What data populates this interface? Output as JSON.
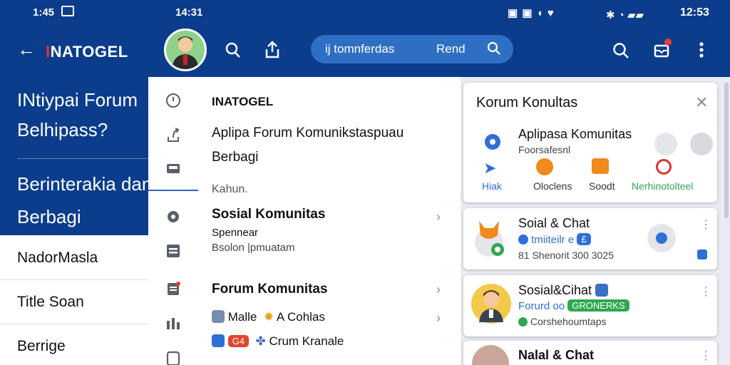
{
  "left_pane": {
    "status_time": "1:45",
    "brand_prefix": "I",
    "brand_rest": "NATOGEL",
    "heading_line1": "INtiypai Forum",
    "heading_line2": "Belhipass?",
    "tagline_line1": "Berinterakia dan",
    "tagline_line2": "Berbagi",
    "menu_items": [
      "NadorMasla",
      "Title Soan",
      "Berrige"
    ]
  },
  "status_bar": {
    "time": "14:31",
    "right_clock": "12:53"
  },
  "search": {
    "text": "ij tomnferdas",
    "action": "Rend"
  },
  "mid_panel": {
    "brand": "INATOGEL",
    "intro_line1": "Aplipa Forum Komunikstaspuau",
    "intro_line2": "Berbagi",
    "section_label": "Kahun.",
    "social_title": "Sosial Komunitas",
    "social_sub1": "Spennear",
    "social_sub2": "Bsolon |pmuatam",
    "forum_title": "Forum Komunitas",
    "forum_item1_a": "Malle",
    "forum_item1_b": "A Cohlas",
    "forum_item2_badge": "G4",
    "forum_item2_text": "Crum Kranale"
  },
  "cards": {
    "komunitas": {
      "title": "Korum Konultas",
      "app_title": "Aplipasa Komunitas",
      "app_sub": "Foorsafesnl",
      "actions": [
        "Hiak",
        "Oloclens",
        "Soodt",
        "Nerhinotolteel"
      ]
    },
    "chat1": {
      "title": "Soial & Chat",
      "handle": "tmiiteilr e",
      "meta": "81 Shenorit 300 3025"
    },
    "chat2": {
      "title": "Sosial&Cihat",
      "handle": "Forurd oo",
      "badge": "GRONERKS",
      "meta": "Corshehoumtaps"
    },
    "chat3": {
      "title": "Nalal & Chat"
    }
  },
  "colors": {
    "header_blue": "#0b3d8c",
    "pill_blue": "#2e6fc4",
    "accent_red": "#e8323c",
    "green": "#2fa84f"
  }
}
